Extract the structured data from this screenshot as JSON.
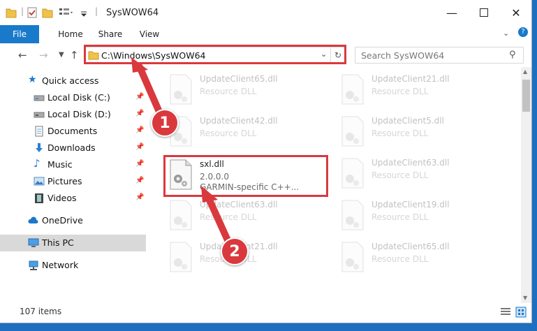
{
  "window": {
    "title": "SysWOW64"
  },
  "ribbon": {
    "tabs": [
      "File",
      "Home",
      "Share",
      "View"
    ]
  },
  "address": {
    "path": "C:\\Windows\\SysWOW64",
    "search_placeholder": "Search SysWOW64"
  },
  "sidebar": {
    "items": [
      {
        "label": "Quick access",
        "icon": "star-icon"
      },
      {
        "label": "Local Disk (C:)",
        "icon": "drive-icon"
      },
      {
        "label": "Local Disk (D:)",
        "icon": "drive-icon"
      },
      {
        "label": "Documents",
        "icon": "documents-icon"
      },
      {
        "label": "Downloads",
        "icon": "download-icon"
      },
      {
        "label": "Music",
        "icon": "music-icon"
      },
      {
        "label": "Pictures",
        "icon": "pictures-icon"
      },
      {
        "label": "Videos",
        "icon": "videos-icon"
      },
      {
        "label": "OneDrive",
        "icon": "cloud-icon"
      },
      {
        "label": "This PC",
        "icon": "computer-icon"
      },
      {
        "label": "Network",
        "icon": "network-icon"
      }
    ]
  },
  "files": {
    "left": [
      {
        "name": "UpdateClient65.dll",
        "type": "Resource DLL"
      },
      {
        "name": "UpdateClient42.dll",
        "type": "Resource DLL"
      },
      {
        "name": "sxl.dll",
        "version": "2.0.0.0",
        "desc": "GARMIN-specific C++..."
      },
      {
        "name": "UpdateClient63.dll",
        "type": "Resource DLL"
      },
      {
        "name": "UpdateClient21.dll",
        "type": "Resource DLL"
      }
    ],
    "right": [
      {
        "name": "UpdateClient21.dll",
        "type": "Resource DLL"
      },
      {
        "name": "UpdateClient5.dll",
        "type": "Resource DLL"
      },
      {
        "name": "UpdateClient63.dll",
        "type": "Resource DLL"
      },
      {
        "name": "UpdateClient19.dll",
        "type": "Resource DLL"
      },
      {
        "name": "UpdateClient65.dll",
        "type": "Resource DLL"
      }
    ]
  },
  "status": {
    "items_count": "107 items"
  },
  "annotations": {
    "step1": "1",
    "step2": "2"
  },
  "colors": {
    "accent": "#1979ca",
    "highlight": "#d9393d"
  }
}
